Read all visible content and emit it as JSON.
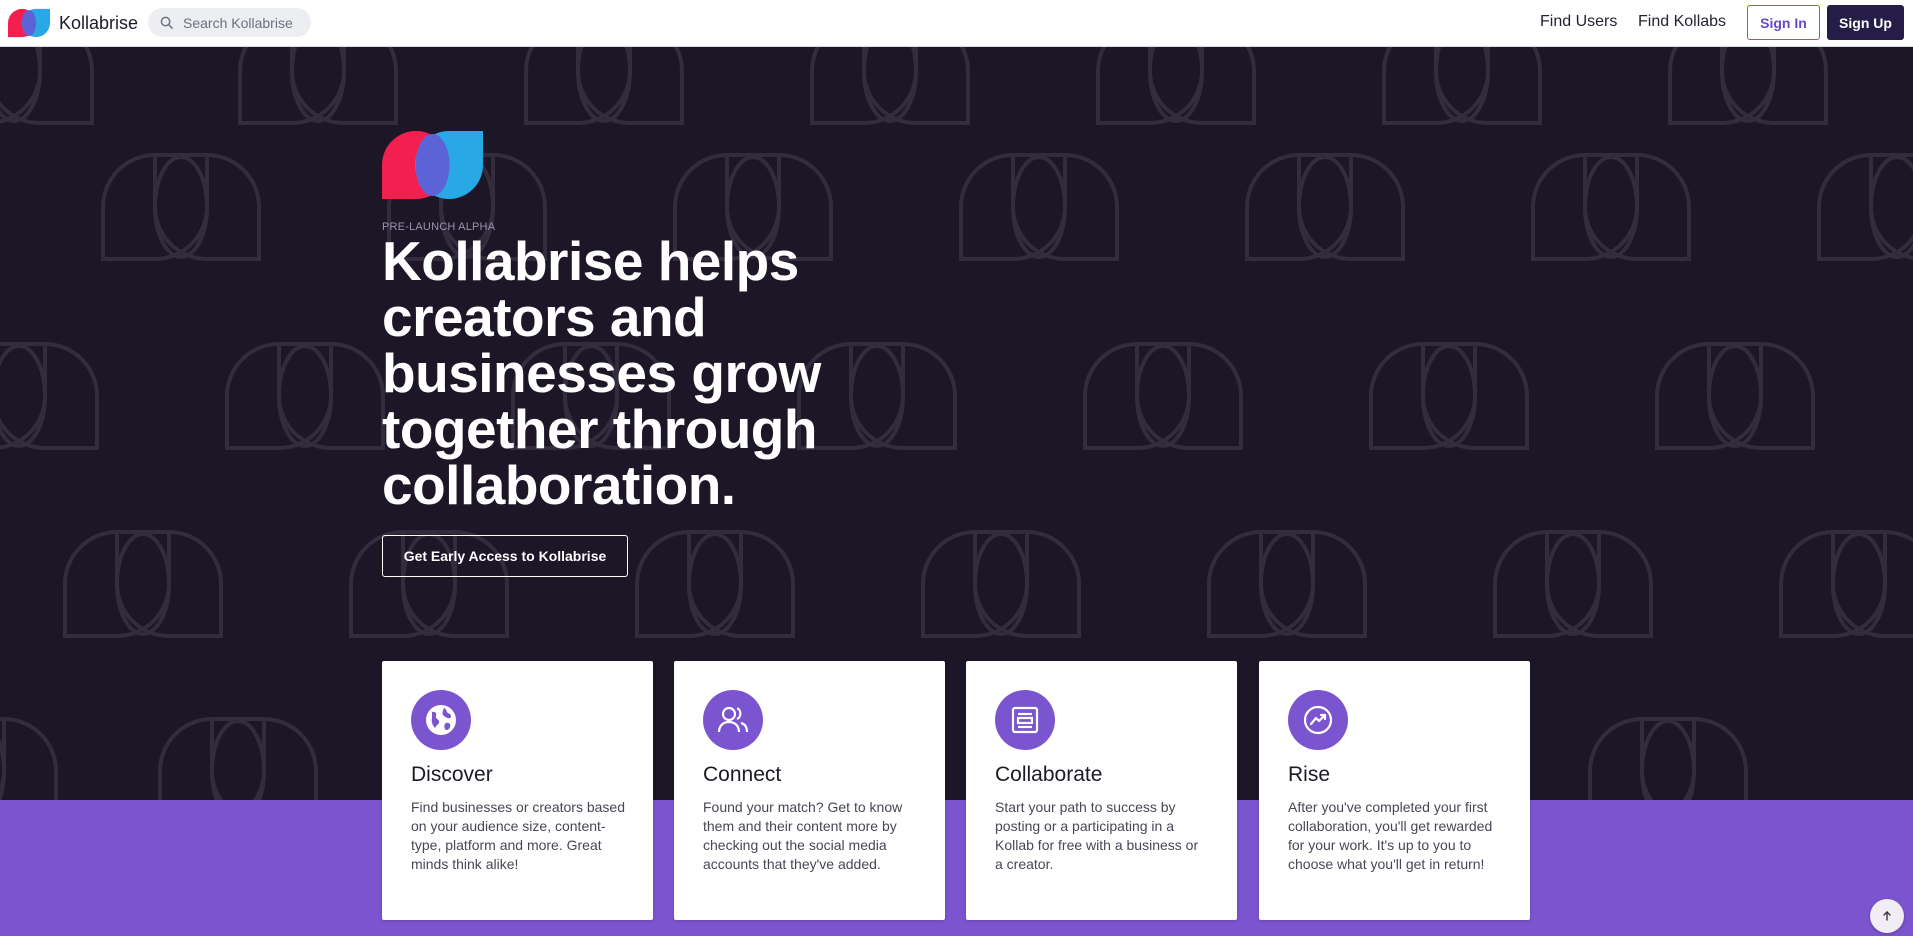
{
  "brand": {
    "name": "Kollabrise"
  },
  "search": {
    "placeholder": "Search Kollabrise"
  },
  "nav": {
    "find_users": "Find Users",
    "find_kollabs": "Find Kollabs",
    "sign_in": "Sign In",
    "sign_up": "Sign Up"
  },
  "hero": {
    "eyebrow": "PRE-LAUNCH ALPHA",
    "headline": "Kollabrise helps creators and businesses grow together through collaboration.",
    "cta": "Get Early Access to Kollabrise"
  },
  "features": [
    {
      "icon": "globe-icon",
      "title": "Discover",
      "text": "Find businesses or creators based on your audience size, content-type, platform and more. Great minds think alike!"
    },
    {
      "icon": "users-icon",
      "title": "Connect",
      "text": "Found your match? Get to know them and their content more by checking out the social media accounts that they've added."
    },
    {
      "icon": "document-icon",
      "title": "Collaborate",
      "text": "Start your path to success by posting or a participating in a Kollab for free with a business or a creator."
    },
    {
      "icon": "trend-up-icon",
      "title": "Rise",
      "text": "After you've completed your first collaboration, you'll get rewarded for your work. It's up to you to choose what you'll get in return!"
    }
  ],
  "colors": {
    "hero_bg": "#1c1626",
    "accent_purple": "#7b54cf",
    "logo_red": "#f3204f",
    "logo_blue": "#29a8e6",
    "logo_overlap": "#5b63d6",
    "signup_bg": "#251c47"
  }
}
